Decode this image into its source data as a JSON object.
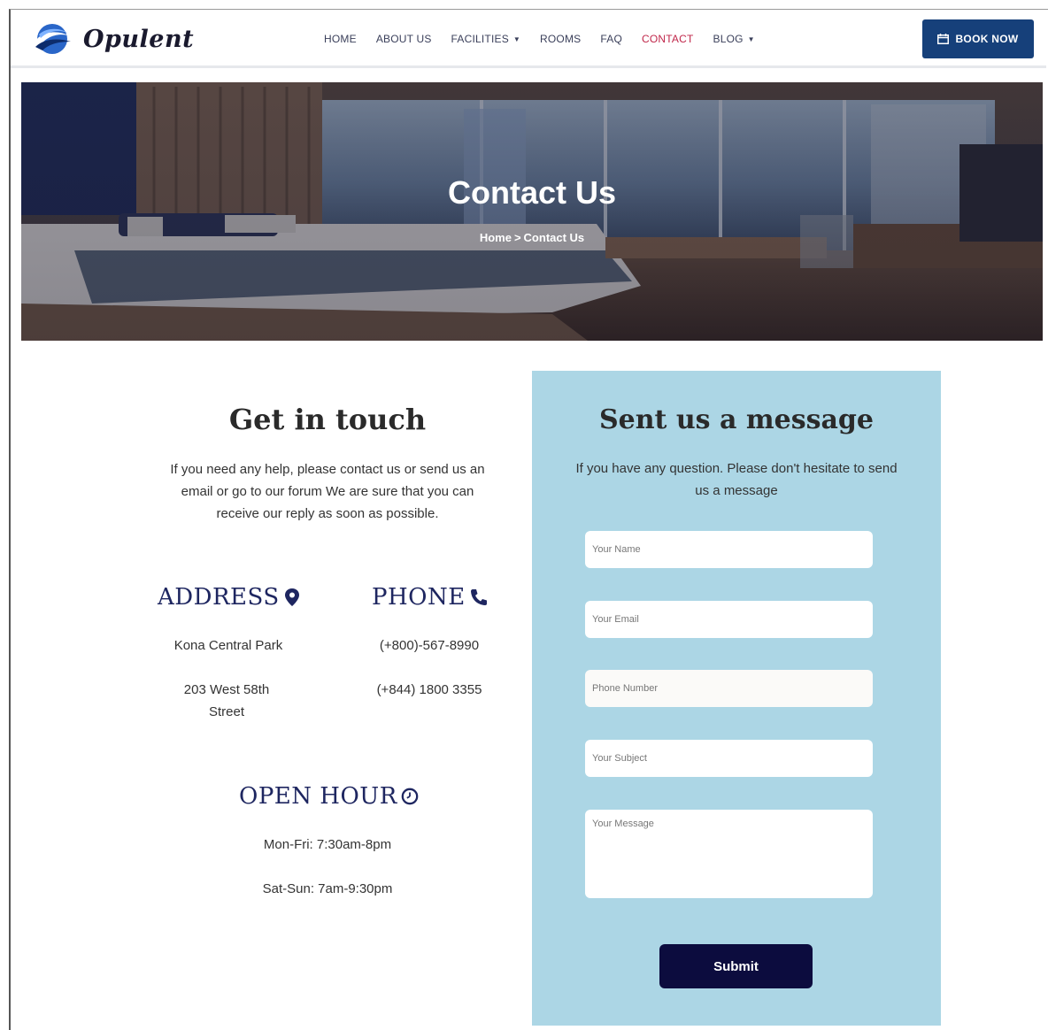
{
  "brand": {
    "name": "Opulent"
  },
  "nav": {
    "items": [
      {
        "label": "HOME",
        "dropdown": false,
        "active": false
      },
      {
        "label": "ABOUT US",
        "dropdown": false,
        "active": false
      },
      {
        "label": "FACILITIES",
        "dropdown": true,
        "active": false
      },
      {
        "label": "ROOMS",
        "dropdown": false,
        "active": false
      },
      {
        "label": "FAQ",
        "dropdown": false,
        "active": false
      },
      {
        "label": "CONTACT",
        "dropdown": false,
        "active": true
      },
      {
        "label": "BLOG",
        "dropdown": true,
        "active": false
      }
    ],
    "book_label": "BOOK NOW"
  },
  "hero": {
    "title": "Contact Us",
    "breadcrumb_home": "Home",
    "breadcrumb_sep": ">",
    "breadcrumb_current": "Contact Us"
  },
  "contact": {
    "title": "Get in touch",
    "text": "If you need any help, please contact us or send us an email or go to our forum We are sure that you can receive our reply as soon as possible.",
    "address_title": "ADDRESS",
    "address_line1": "Kona Central Park",
    "address_line2": "203 West 58th Street",
    "phone_title": "PHONE",
    "phone1": "(+800)-567-8990",
    "phone2": "(+844) 1800 3355",
    "hours_title": "OPEN HOUR",
    "hours1": "Mon-Fri: 7:30am-8pm",
    "hours2": "Sat-Sun: 7am-9:30pm"
  },
  "form": {
    "title": "Sent us a message",
    "text": "If you have any question. Please don't hesitate to send us a message",
    "name_placeholder": "Your Name",
    "email_placeholder": "Your Email",
    "phone_placeholder": "Phone Number",
    "subject_placeholder": "Your Subject",
    "message_placeholder": "Your Message",
    "submit_label": "Submit"
  },
  "colors": {
    "accent": "#16407a",
    "active_nav": "#c0264a",
    "heading_navy": "#1e2660",
    "panel_bg": "#acd6e5",
    "submit_bg": "#0c0c3e"
  },
  "icons": [
    "logo-wave-icon",
    "chevron-down-icon",
    "calendar-icon",
    "map-pin-icon",
    "phone-icon",
    "clock-icon"
  ]
}
